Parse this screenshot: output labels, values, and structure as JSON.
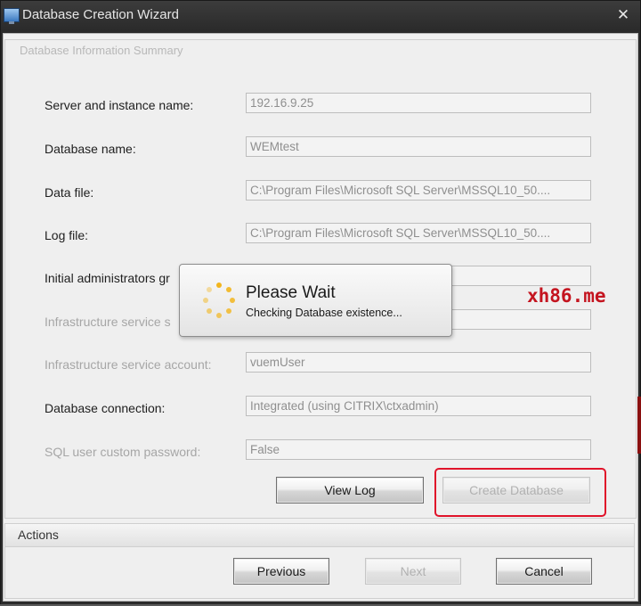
{
  "window": {
    "title": "Database Creation Wizard",
    "close_glyph": "✕",
    "icon": "monitor-icon"
  },
  "summary": {
    "legend": "Database Information Summary",
    "rows": [
      {
        "label": "Server and instance name:",
        "value": "192.16.9.25"
      },
      {
        "label": "Database name:",
        "value": "WEMtest"
      },
      {
        "label": "Data file:",
        "value": "C:\\Program Files\\Microsoft SQL Server\\MSSQL10_50...."
      },
      {
        "label": "Log file:",
        "value": "C:\\Program Files\\Microsoft SQL Server\\MSSQL10_50...."
      },
      {
        "label": "Initial administrators gr",
        "value": ""
      },
      {
        "label": "Infrastructure service s",
        "value": ""
      },
      {
        "label": "Infrastructure service account:",
        "value": "vuemUser"
      },
      {
        "label": "Database connection:",
        "value": "Integrated (using CITRIX\\ctxadmin)"
      },
      {
        "label": "SQL user custom password:",
        "value": "False"
      }
    ]
  },
  "buttons": {
    "view_log": "View Log",
    "create_database": "Create Database"
  },
  "actions": {
    "label": "Actions",
    "previous": "Previous",
    "next": "Next",
    "cancel": "Cancel"
  },
  "wait_dialog": {
    "title": "Please Wait",
    "message": "Checking Database existence...",
    "icon": "loading-spinner-icon"
  },
  "watermark": "xh86.me",
  "colors": {
    "highlight": "#e0132a",
    "spinner": "#f2b51c",
    "watermark": "#c4141f"
  }
}
